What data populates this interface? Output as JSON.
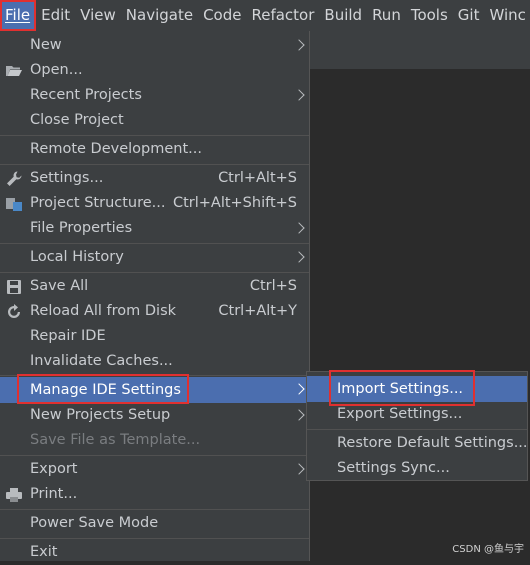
{
  "menubar": {
    "items": [
      {
        "label": "File"
      },
      {
        "label": "Edit"
      },
      {
        "label": "View"
      },
      {
        "label": "Navigate"
      },
      {
        "label": "Code"
      },
      {
        "label": "Refactor"
      },
      {
        "label": "Build"
      },
      {
        "label": "Run"
      },
      {
        "label": "Tools"
      },
      {
        "label": "Git"
      },
      {
        "label": "Winc"
      }
    ]
  },
  "file_menu": {
    "new": "New",
    "open": "Open...",
    "recent_projects": "Recent Projects",
    "close_project": "Close Project",
    "remote_development": "Remote Development...",
    "settings": "Settings...",
    "settings_shortcut": "Ctrl+Alt+S",
    "project_structure": "Project Structure...",
    "project_structure_shortcut": "Ctrl+Alt+Shift+S",
    "file_properties": "File Properties",
    "local_history": "Local History",
    "save_all": "Save All",
    "save_all_shortcut": "Ctrl+S",
    "reload_all": "Reload All from Disk",
    "reload_all_shortcut": "Ctrl+Alt+Y",
    "repair_ide": "Repair IDE",
    "invalidate_caches": "Invalidate Caches...",
    "manage_ide_settings": "Manage IDE Settings",
    "new_projects_setup": "New Projects Setup",
    "save_file_as_template": "Save File as Template...",
    "export": "Export",
    "print": "Print...",
    "power_save_mode": "Power Save Mode",
    "exit": "Exit"
  },
  "submenu": {
    "import_settings": "Import Settings...",
    "export_settings": "Export Settings...",
    "restore_default": "Restore Default Settings...",
    "settings_sync": "Settings Sync..."
  },
  "colors": {
    "menu_bg": "#3c3f41",
    "selection": "#4b6eaf",
    "highlight_border": "#e03030"
  },
  "watermark": "CSDN @鱼与宇"
}
